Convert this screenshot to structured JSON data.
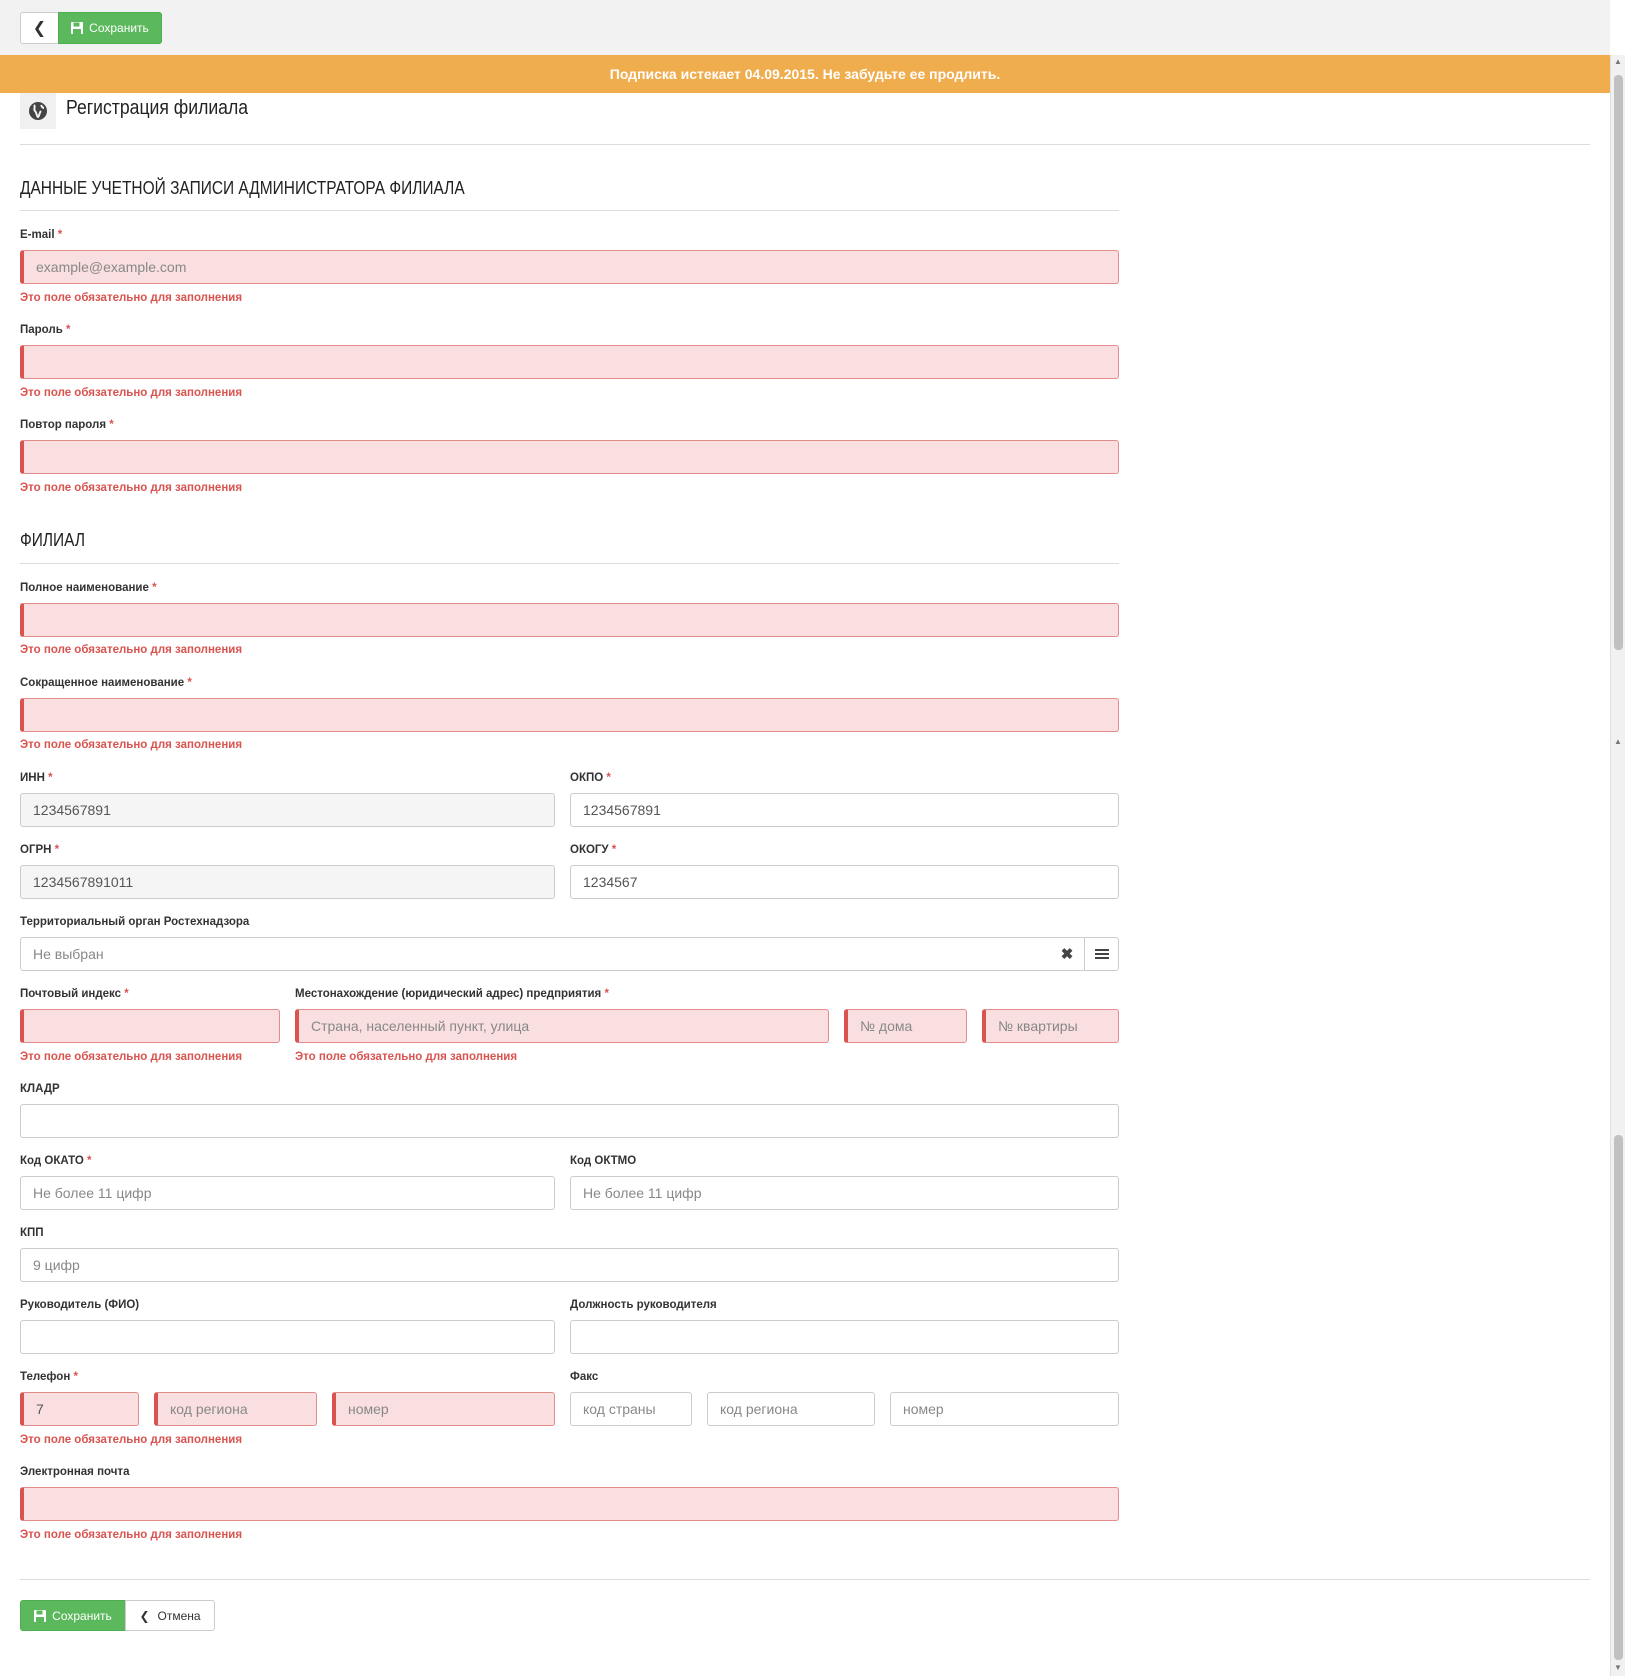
{
  "toolbar": {
    "save_label": "Сохранить"
  },
  "banner": {
    "text": "Подписка истекает 04.09.2015. Не забудьте ее продлить."
  },
  "header": {
    "title": "Регистрация филиала"
  },
  "required_mark": "*",
  "error_text": "Это поле обязательно для заполнения",
  "admin_section": {
    "title": "Данные учетной записи администратора филиала",
    "email_label": "E-mail",
    "email_placeholder": "example@example.com",
    "password_label": "Пароль",
    "password_repeat_label": "Повтор пароля"
  },
  "branch_section": {
    "title": "Филиал",
    "full_name_label": "Полное наименование",
    "short_name_label": "Сокращенное наименование",
    "inn_label": "ИНН",
    "inn_value": "1234567891",
    "okpo_label": "ОКПО",
    "okpo_value": "1234567891",
    "ogrn_label": "ОГРН",
    "ogrn_value": "1234567891011",
    "okogu_label": "ОКОГУ",
    "okogu_value": "1234567",
    "rtn_label": "Территориальный орган Ростехнадзора",
    "rtn_value": "Не выбран",
    "postal_label": "Почтовый индекс",
    "address_label": "Местонахождение (юридический адрес) предприятия",
    "address_placeholder": "Страна, населенный пункт, улица",
    "house_placeholder": "№ дома",
    "apartment_placeholder": "№ квартиры",
    "kladr_label": "КЛАДР",
    "okato_label": "Код ОКАТО",
    "okato_placeholder": "Не более 11 цифр",
    "oktmo_label": "Код ОКТМО",
    "oktmo_placeholder": "Не более 11 цифр",
    "kpp_label": "КПП",
    "kpp_placeholder": "9 цифр",
    "head_label": "Руководитель (ФИО)",
    "head_position_label": "Должность руководителя",
    "phone_label": "Телефон",
    "phone_country_value": "7",
    "phone_region_placeholder": "код региона",
    "phone_number_placeholder": "номер",
    "fax_label": "Факс",
    "fax_country_placeholder": "код страны",
    "fax_region_placeholder": "код региона",
    "fax_number_placeholder": "номер",
    "email_label": "Электронная почта"
  },
  "footer": {
    "save_label": "Сохранить",
    "cancel_label": "Отмена"
  },
  "colors": {
    "success": "#5cb85c",
    "warning": "#f0ad4e",
    "danger": "#d9534f",
    "error_bg": "#f9dfdf"
  },
  "icons": [
    "chevron-left-icon",
    "floppy-disk-icon",
    "globe-icon",
    "close-icon",
    "list-icon"
  ]
}
